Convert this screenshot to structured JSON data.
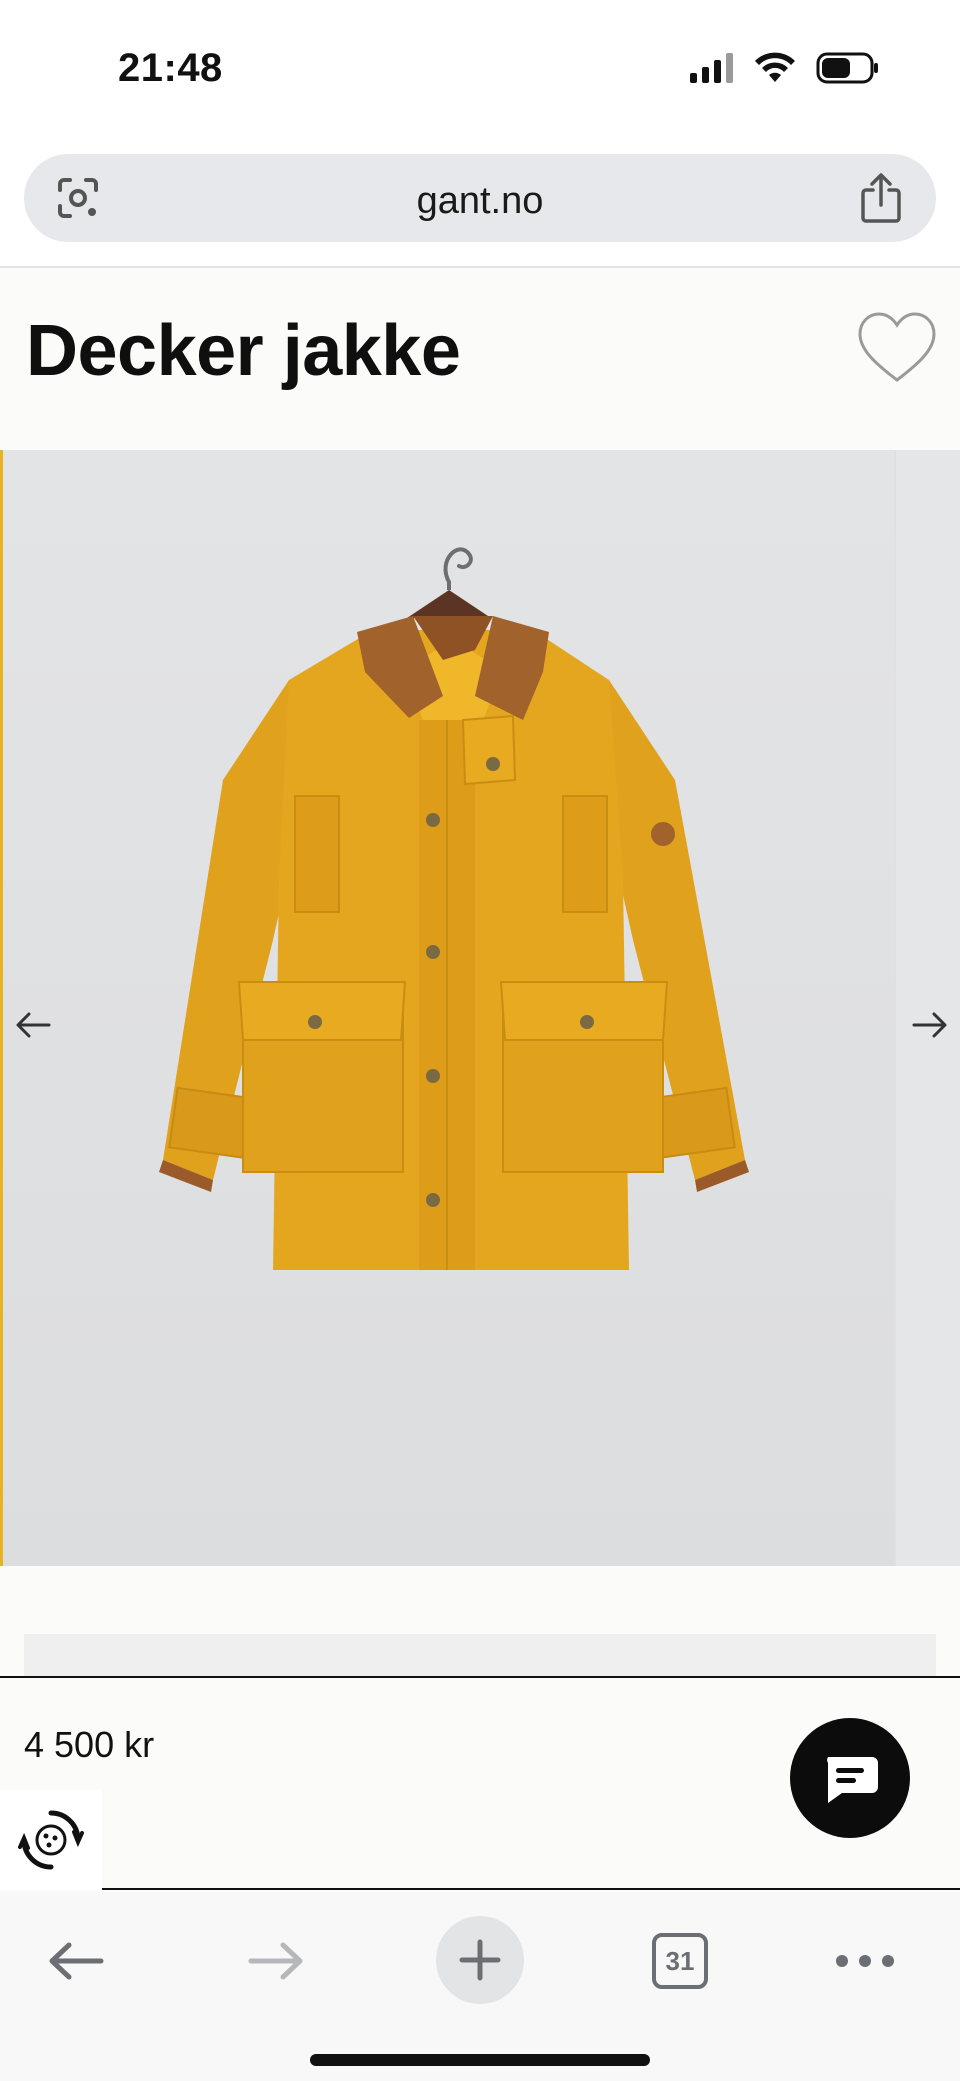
{
  "status_bar": {
    "time": "21:48",
    "icons": [
      "signal-icon",
      "wifi-icon",
      "battery-icon"
    ]
  },
  "browser": {
    "address": "gant.no",
    "icons": {
      "left": "lens-icon",
      "right": "share-icon"
    }
  },
  "product": {
    "title": "Decker jakke",
    "price": "4 500 kr",
    "image_subject": "mustard yellow jacket with brown corduroy collar on hanger",
    "colors": {
      "jacket": "#e3a41c",
      "collar": "#a2622b",
      "background": "#dfe0e2"
    }
  },
  "toolbar": {
    "tabs_count": "31",
    "items": [
      "back-arrow-icon",
      "forward-arrow-icon",
      "new-tab-icon",
      "tabs-icon",
      "more-icon"
    ]
  }
}
